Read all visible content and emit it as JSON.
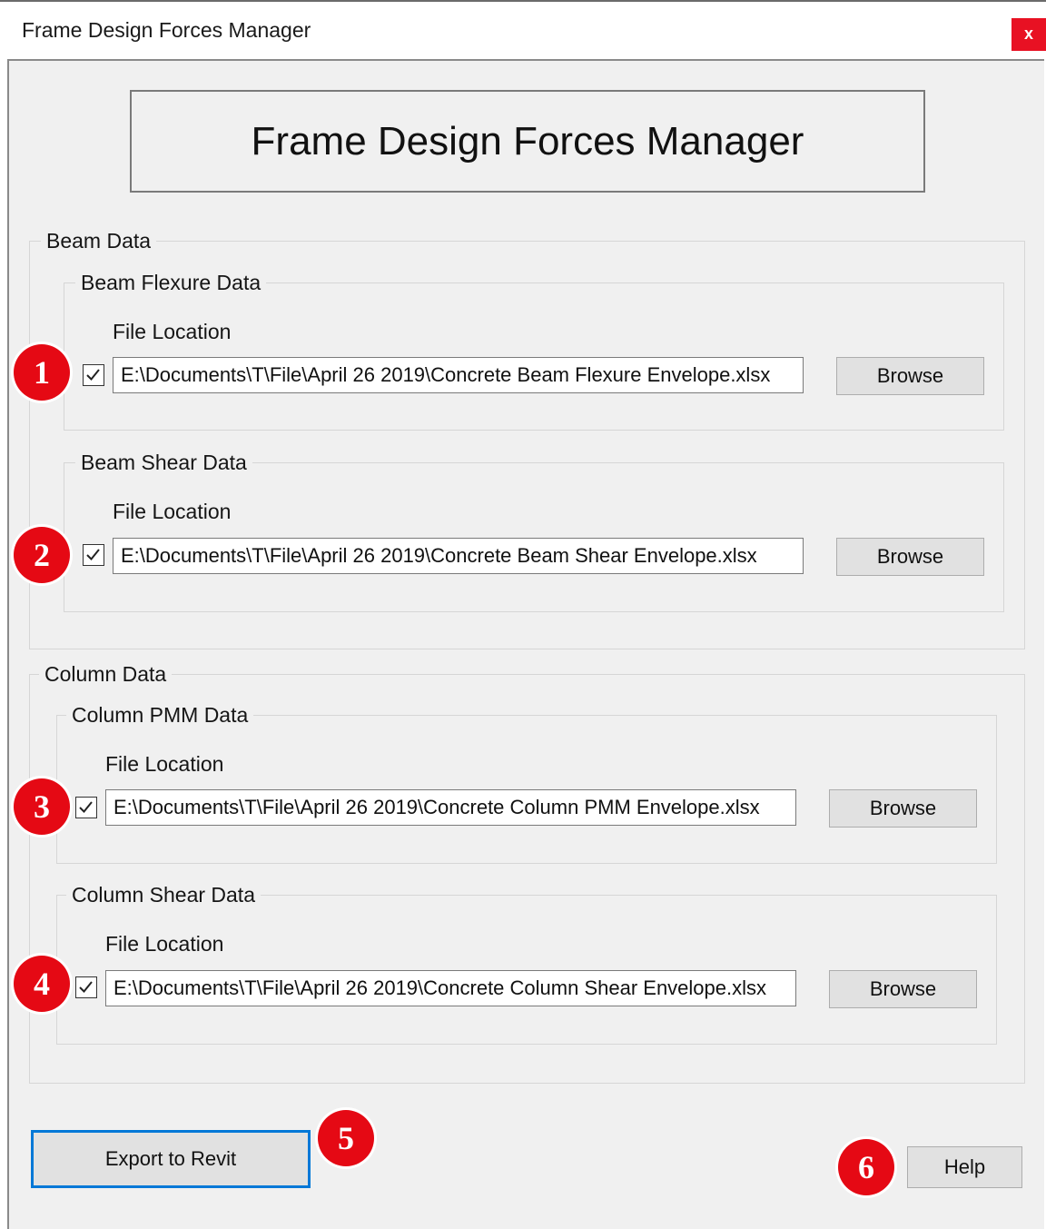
{
  "window": {
    "title": "Frame Design Forces Manager",
    "close_label": "x"
  },
  "header": {
    "title": "Frame Design Forces Manager"
  },
  "beam_group": {
    "legend": "Beam Data",
    "flexure": {
      "legend": "Beam Flexure Data",
      "file_label": "File Location",
      "checked": true,
      "path": "E:\\Documents\\T\\File\\April 26 2019\\Concrete Beam Flexure Envelope.xlsx",
      "browse_label": "Browse"
    },
    "shear": {
      "legend": "Beam Shear Data",
      "file_label": "File Location",
      "checked": true,
      "path": "E:\\Documents\\T\\File\\April 26 2019\\Concrete Beam Shear Envelope.xlsx",
      "browse_label": "Browse"
    }
  },
  "column_group": {
    "legend": "Column Data",
    "pmm": {
      "legend": "Column PMM Data",
      "file_label": "File Location",
      "checked": true,
      "path": "E:\\Documents\\T\\File\\April 26 2019\\Concrete Column PMM Envelope.xlsx",
      "browse_label": "Browse"
    },
    "shear": {
      "legend": "Column Shear Data",
      "file_label": "File Location",
      "checked": true,
      "path": "E:\\Documents\\T\\File\\April 26 2019\\Concrete Column Shear Envelope.xlsx",
      "browse_label": "Browse"
    }
  },
  "actions": {
    "export_label": "Export to Revit",
    "help_label": "Help"
  },
  "annotations": [
    "1",
    "2",
    "3",
    "4",
    "5",
    "6"
  ],
  "colors": {
    "badge": "#e50914",
    "close_button": "#e81123",
    "focus_border": "#0078d7",
    "window_bg": "#f0f0f0"
  }
}
